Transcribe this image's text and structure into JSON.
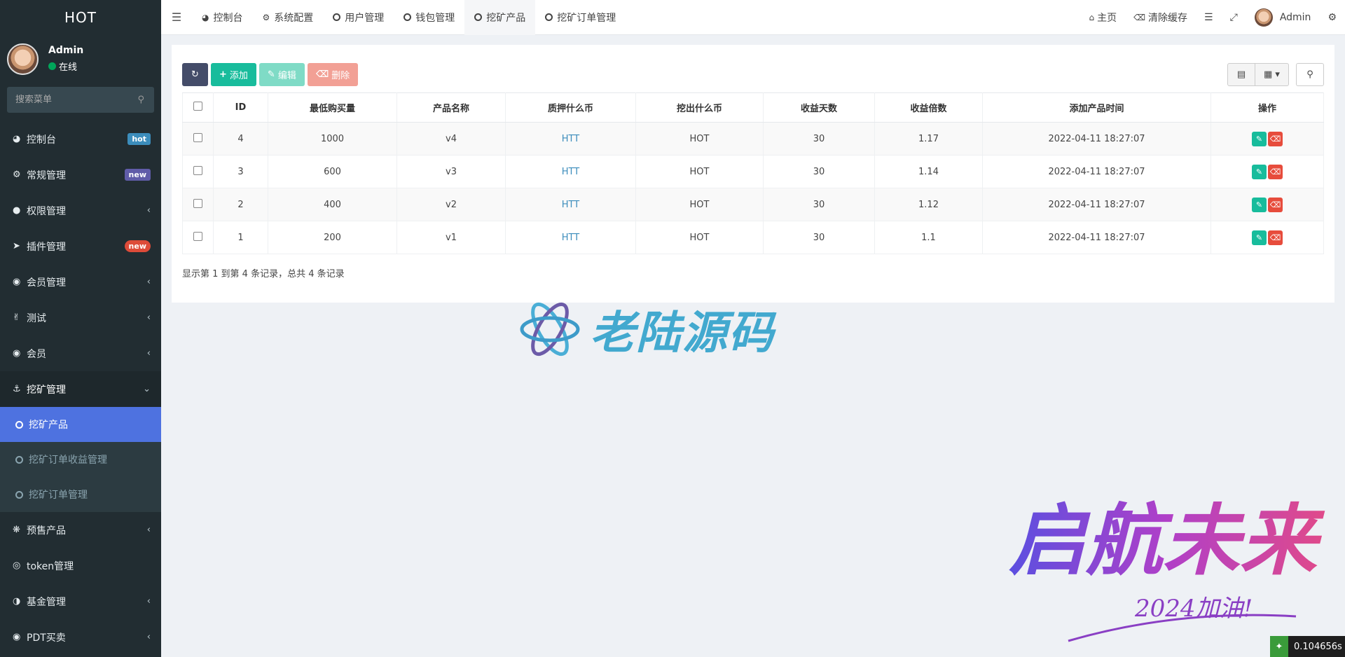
{
  "sidebar": {
    "logo": "HOT",
    "user": {
      "name": "Admin",
      "status": "在线"
    },
    "search_placeholder": "搜索菜单",
    "items": [
      {
        "label": "控制台",
        "badge": "hot",
        "badge_color": "#3c8dbc"
      },
      {
        "label": "常规管理",
        "badge": "new",
        "badge_color": "#605ca8"
      },
      {
        "label": "权限管理"
      },
      {
        "label": "插件管理",
        "badge": "new",
        "badge_color": "#dd4b39"
      },
      {
        "label": "会员管理"
      },
      {
        "label": "测试"
      },
      {
        "label": "会员"
      },
      {
        "label": "挖矿管理"
      }
    ],
    "submenu": [
      {
        "label": "挖矿产品",
        "active": true
      },
      {
        "label": "挖矿订单收益管理"
      },
      {
        "label": "挖矿订单管理"
      }
    ],
    "items_after": [
      {
        "label": "预售产品"
      },
      {
        "label": "token管理"
      },
      {
        "label": "基金管理"
      },
      {
        "label": "PDT买卖"
      }
    ]
  },
  "topbar": {
    "tabs": [
      "控制台",
      "系统配置",
      "用户管理",
      "钱包管理",
      "挖矿产品",
      "挖矿订单管理"
    ],
    "home": "主页",
    "clear_cache": "清除缓存",
    "admin": "Admin"
  },
  "toolbar": {
    "add": "添加",
    "edit": "编辑",
    "delete": "删除"
  },
  "table": {
    "headers": [
      "ID",
      "最低购买量",
      "产品名称",
      "质押什么币",
      "挖出什么币",
      "收益天数",
      "收益倍数",
      "添加产品时间",
      "操作"
    ],
    "rows": [
      {
        "id": "4",
        "min": "1000",
        "name": "v4",
        "stake": "HTT",
        "mine": "HOT",
        "days": "30",
        "mult": "1.17",
        "time": "2022-04-11 18:27:07"
      },
      {
        "id": "3",
        "min": "600",
        "name": "v3",
        "stake": "HTT",
        "mine": "HOT",
        "days": "30",
        "mult": "1.14",
        "time": "2022-04-11 18:27:07"
      },
      {
        "id": "2",
        "min": "400",
        "name": "v2",
        "stake": "HTT",
        "mine": "HOT",
        "days": "30",
        "mult": "1.12",
        "time": "2022-04-11 18:27:07"
      },
      {
        "id": "1",
        "min": "200",
        "name": "v1",
        "stake": "HTT",
        "mine": "HOT",
        "days": "30",
        "mult": "1.1",
        "time": "2022-04-11 18:27:07"
      }
    ],
    "pager": "显示第 1 到第 4 条记录，总共 4 条记录"
  },
  "watermark": {
    "text": "老陆源码",
    "brush": "启航未来",
    "brush_sub": "2024加油!"
  },
  "timer": "0.104656s"
}
